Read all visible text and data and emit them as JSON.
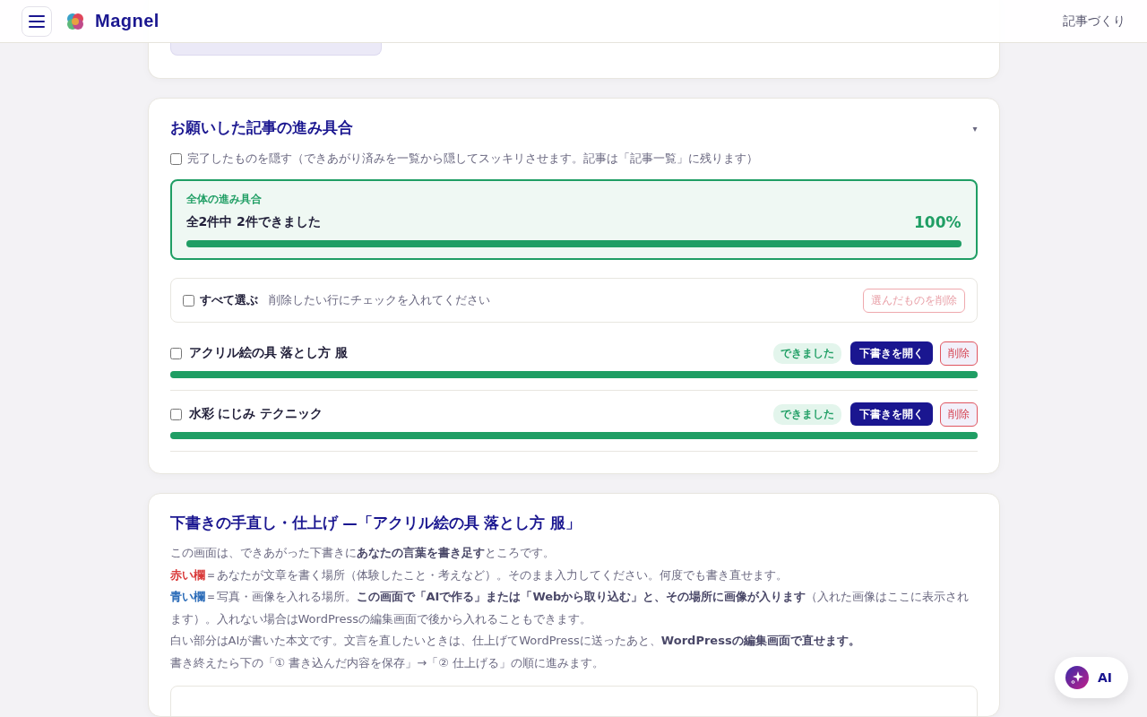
{
  "header": {
    "app_name": "Magnel",
    "nav_link": "記事づくり"
  },
  "progress_card": {
    "title": "お願いした記事の進み具合",
    "toggle": "▾",
    "hide_done": {
      "label": "完了したものを隠す（できあがり済みを一覧から隠してスッキリさせます。記事は「記事一覧」に残ります）",
      "checked": false
    },
    "overall": {
      "caption": "全体の進み具合",
      "summary": "全2件中 2件できました",
      "percent": "100%",
      "level": 1
    },
    "bulk": {
      "label": "すべて選ぶ",
      "checked": false,
      "hint": "削除したい行にチェックを入れてください",
      "delete_button": "選んだものを削除",
      "disabled": true
    },
    "articles": [
      {
        "title": "アクリル絵の具 落とし方 服",
        "checked": false,
        "status": "できました",
        "open_button": "下書きを開く",
        "delete_button": "削除",
        "level": 1
      },
      {
        "title": "水彩 にじみ テクニック",
        "checked": false,
        "status": "できました",
        "open_button": "下書きを開く",
        "delete_button": "削除",
        "level": 1
      }
    ]
  },
  "edit_card": {
    "title": "下書きの手直し・仕上げ —「アクリル絵の具 落とし方 服」",
    "lines": [
      {
        "text": "この画面は、できあがった下書きに**あなたの言葉を書き足す**ところです。"
      },
      {
        "label": "赤い欄",
        "color": "#d93a3a",
        "text": "＝あなたが文章を書く場所（体験したこと・考えなど）。そのまま入力してください。何度でも書き直せます。"
      },
      {
        "label": "青い欄",
        "color": "#2a6bb8",
        "text": "＝写真・画像を入れる場所。**この画面で「AIで作る」または「Webから取り込む」と、その場所に画像が入ります**（入れた画像はここに表示されます）。入れない場合はWordPressの編集画面で後から入れることもできます。"
      },
      {
        "text": "白い部分はAIが書いた本文です。文言を直したいときは、仕上げてWordPressに送ったあと、**WordPressの編集画面で直せます。**"
      },
      {
        "text": "書き終えたら下の「① 書き込んだ内容を保存」→「② 仕上げる」の順に進みます。"
      }
    ]
  },
  "ai_button": {
    "label": "AI"
  }
}
